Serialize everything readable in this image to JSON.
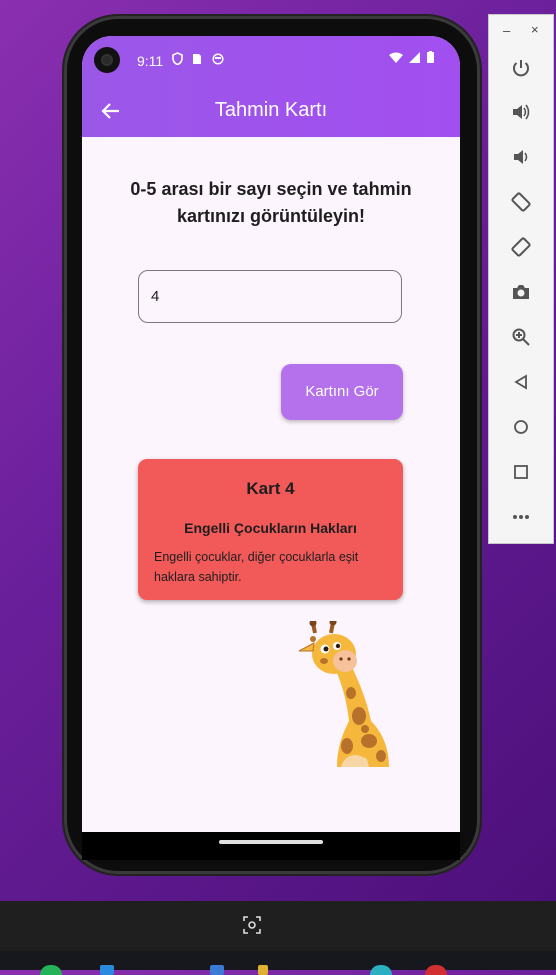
{
  "status_bar": {
    "time": "9:11",
    "left_icons": [
      "shield-icon",
      "sim-icon",
      "face-icon"
    ],
    "right_icons": [
      "wifi-icon",
      "signal-icon",
      "battery-icon"
    ]
  },
  "app_bar": {
    "title": "Tahmin Kartı",
    "back_icon": "arrow-left-icon"
  },
  "main": {
    "instruction": "0-5 arası bir sayı seçin ve tahmin kartınızı görüntüleyin!",
    "input_value": "4",
    "button_label": "Kartını Gör"
  },
  "card": {
    "title": "Kart 4",
    "subtitle": "Engelli Çocukların Hakları",
    "text": "Engelli çocuklar, diğer çocuklarla eşit haklara sahiptir.",
    "color": "#f15a59"
  },
  "emulator_panel": {
    "minimize": "–",
    "close": "×",
    "buttons": [
      "power-icon",
      "volume-up-icon",
      "volume-down-icon",
      "rotate-left-icon",
      "rotate-right-icon",
      "camera-icon",
      "zoom-icon",
      "back-triangle-icon",
      "home-circle-icon",
      "overview-square-icon",
      "more-icon"
    ]
  },
  "colors": {
    "accent": "#a24ff0",
    "button": "#b570ec",
    "background": "#fdf5fd"
  }
}
